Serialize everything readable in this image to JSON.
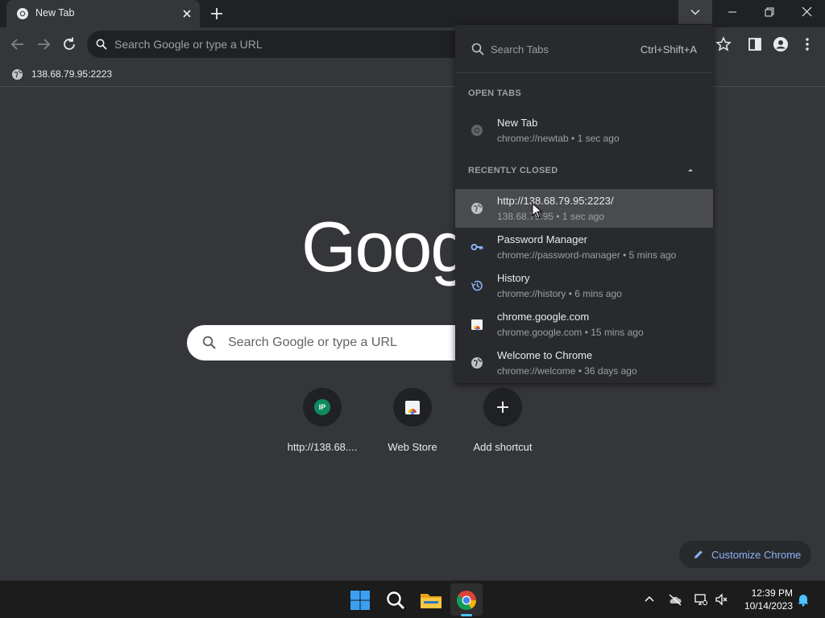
{
  "browser": {
    "tab": {
      "title": "New Tab"
    },
    "toolbar": {
      "omnibox_placeholder": "Search Google or type a URL"
    },
    "bookmarks": [
      {
        "label": "138.68.79.95:2223"
      }
    ]
  },
  "ntp": {
    "search_placeholder": "Search Google or type a URL",
    "shortcuts": [
      {
        "label": "http://138.68....",
        "icon_text": "IP",
        "icon_color": "#0f8a5f"
      },
      {
        "label": "Web Store",
        "icon": "chrome-web-store-icon"
      },
      {
        "label": "Add shortcut",
        "icon": "plus-icon"
      }
    ],
    "customize_label": "Customize Chrome"
  },
  "tab_search": {
    "placeholder": "Search Tabs",
    "shortcut": "Ctrl+Shift+A",
    "open_tabs_header": "OPEN TABS",
    "open_tabs": [
      {
        "title": "New Tab",
        "subtitle": "chrome://newtab • 1 sec ago",
        "icon": "chrome-icon"
      }
    ],
    "recently_closed_header": "RECENTLY CLOSED",
    "recently_closed": [
      {
        "title": "http://138.68.79.95:2223/",
        "subtitle": "138.68.79.95 • 1 sec ago",
        "icon": "globe-icon"
      },
      {
        "title": "Password Manager",
        "subtitle": "chrome://password-manager • 5 mins ago",
        "icon": "key-icon"
      },
      {
        "title": "History",
        "subtitle": "chrome://history • 6 mins ago",
        "icon": "history-icon"
      },
      {
        "title": "chrome.google.com",
        "subtitle": "chrome.google.com • 15 mins ago",
        "icon": "web-store-icon"
      },
      {
        "title": "Welcome to Chrome",
        "subtitle": "chrome://welcome • 36 days ago",
        "icon": "globe-icon"
      }
    ]
  },
  "taskbar": {
    "time": "12:39 PM",
    "date": "10/14/2023"
  },
  "colors": {
    "accent": "#8ab4f8",
    "taskbar_indicator": "#4cc2ff"
  }
}
